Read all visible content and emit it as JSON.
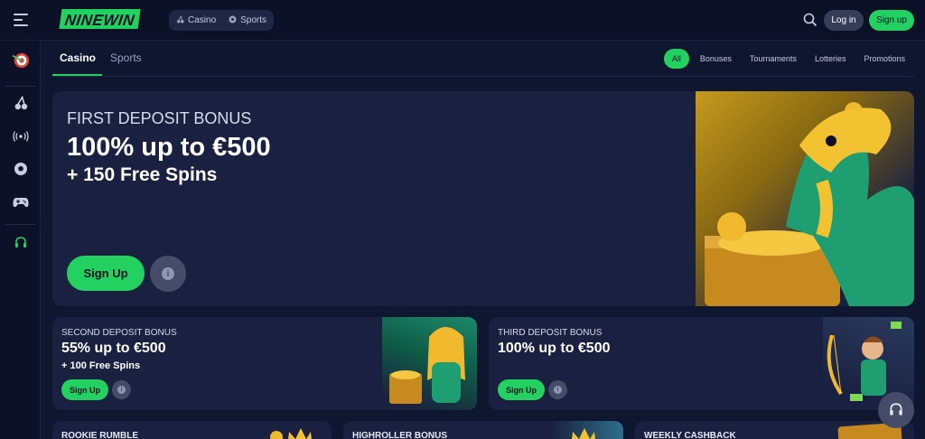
{
  "header": {
    "logo": "NINEWIN",
    "nav": [
      {
        "label": "Casino",
        "icon": "cherry-icon"
      },
      {
        "label": "Sports",
        "icon": "soccer-ball-icon"
      }
    ],
    "login_label": "Log in",
    "signup_label": "Sign up"
  },
  "sidebar": {
    "items": [
      {
        "icon": "dart-target-icon"
      },
      {
        "icon": "cherry-icon"
      },
      {
        "icon": "live-broadcast-icon"
      },
      {
        "icon": "soccer-ball-icon"
      },
      {
        "icon": "gamepad-icon"
      },
      {
        "icon": "headset-icon"
      }
    ]
  },
  "tabs": [
    {
      "label": "Casino",
      "active": true
    },
    {
      "label": "Sports",
      "active": false
    }
  ],
  "filters": [
    {
      "label": "All",
      "active": true
    },
    {
      "label": "Bonuses",
      "active": false
    },
    {
      "label": "Tournaments",
      "active": false
    },
    {
      "label": "Lotteries",
      "active": false
    },
    {
      "label": "Promotions",
      "active": false
    }
  ],
  "hero": {
    "kicker": "FIRST DEPOSIT BONUS",
    "title": "100% up to €500",
    "subtitle": "+ 150 Free Spins",
    "signup_label": "Sign Up"
  },
  "cards": [
    {
      "kicker": "SECOND DEPOSIT BONUS",
      "title": "55% up to €500",
      "subtitle": "+ 100 Free Spins",
      "signup_label": "Sign Up"
    },
    {
      "kicker": "THIRD DEPOSIT BONUS",
      "title": "100% up to €500",
      "subtitle": "",
      "signup_label": "Sign Up"
    }
  ],
  "promos": [
    {
      "label": "ROOKIE RUMBLE"
    },
    {
      "label": "HIGHROLLER BONUS"
    },
    {
      "label": "WEEKLY CASHBACK"
    }
  ],
  "colors": {
    "accent": "#23d160",
    "background": "#0f1630",
    "panel": "#1a2140"
  }
}
